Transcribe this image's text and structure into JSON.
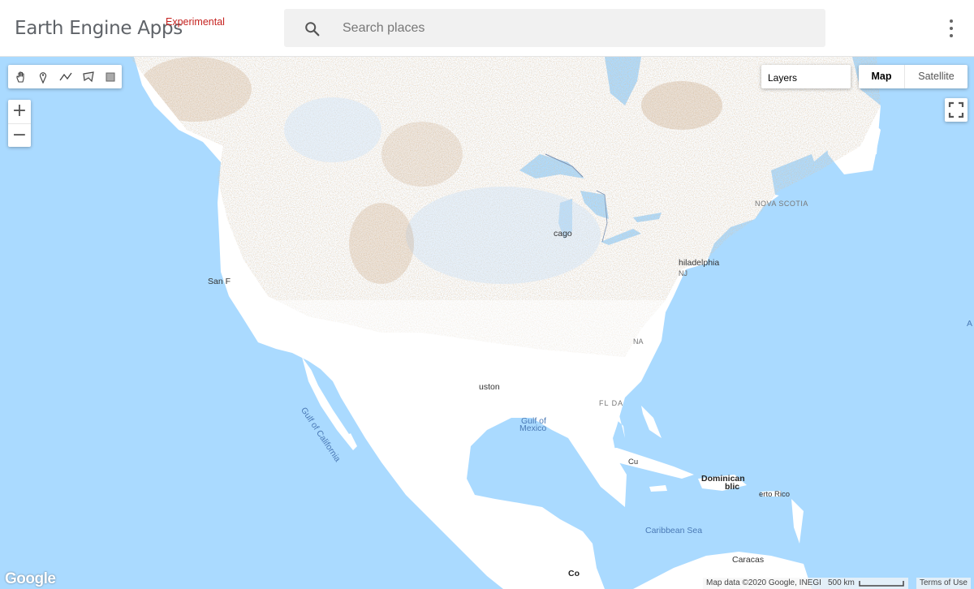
{
  "app": {
    "title": "Earth Engine Apps",
    "tag": "Experimental"
  },
  "search": {
    "placeholder": "Search places"
  },
  "map_controls": {
    "tools": [
      "pan-hand",
      "point-marker",
      "line",
      "polygon",
      "rectangle"
    ],
    "zoom_in": "+",
    "zoom_out": "−",
    "layers_label": "Layers",
    "map_type_map": "Map",
    "map_type_satellite": "Satellite"
  },
  "labels": {
    "san_francisco": "San F",
    "chicago": "cago",
    "philadelphia": "hiladelphia",
    "nj": "NJ",
    "nova_scotia": "NOVA SCOTIA",
    "houston": "uston",
    "florida": "FL DA",
    "carolina": "NA",
    "gulf_of_mexico_1": "Gulf of",
    "gulf_of_mexico_2": "Mexico",
    "gulf_of_california": "Gulf of California",
    "dominican_1": "Dominican",
    "dominican_2": "blic",
    "puerto_rico": "erto Rico",
    "caribbean_sea": "Caribbean Sea",
    "caracas": "Caracas",
    "cuba": "Cu",
    "colombia": "Co",
    "atlantic": "A"
  },
  "footer": {
    "logo": "Google",
    "map_data": "Map data ©2020 Google, INEGI",
    "scale": "500 km",
    "terms": "Terms of Use"
  },
  "colors": {
    "water": "#aadaff",
    "land": "#ffffff",
    "dry_anomaly": "#c9a27a",
    "wet_anomaly": "#b9d6f2",
    "experimental_tag": "#c5221f"
  }
}
